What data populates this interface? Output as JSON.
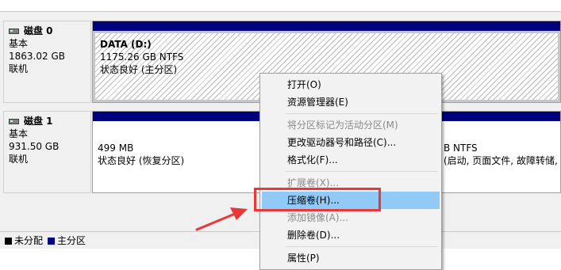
{
  "disks": [
    {
      "name": "磁盘 0",
      "type": "基本",
      "size": "1863.02 GB",
      "status": "联机",
      "volumes": [
        {
          "name": "DATA  (D:)",
          "size_fs": "1175.26 GB NTFS",
          "status": "状态良好 (主分区)"
        }
      ]
    },
    {
      "name": "磁盘 1",
      "type": "基本",
      "size": "931.50 GB",
      "status": "联机",
      "volumes": [
        {
          "size_fs": "499 MB",
          "status": "状态良好 (恢复分区)"
        },
        {
          "size_fs": "B NTFS",
          "status": "(启动, 页面文件, 故障转储, 主"
        }
      ]
    }
  ],
  "legend": [
    {
      "label": "未分配",
      "color": "#000000"
    },
    {
      "label": "主分区",
      "color": "#00007f"
    }
  ],
  "context_menu": {
    "items": [
      {
        "label": "打开(O)",
        "enabled": true
      },
      {
        "label": "资源管理器(E)",
        "enabled": true
      },
      {
        "label": "将分区标记为活动分区(M)",
        "enabled": false
      },
      {
        "label": "更改驱动器号和路径(C)...",
        "enabled": true
      },
      {
        "label": "格式化(F)...",
        "enabled": true
      },
      {
        "label": "扩展卷(X)...",
        "enabled": false
      },
      {
        "label": "压缩卷(H)...",
        "enabled": true,
        "highlighted": true
      },
      {
        "label": "添加镜像(A)...",
        "enabled": false
      },
      {
        "label": "删除卷(D)...",
        "enabled": true
      },
      {
        "label": "属性(P)",
        "enabled": true
      }
    ]
  },
  "colors": {
    "volume_header": "#00007f",
    "menu_highlight": "#91c9f7",
    "annotation_red": "#e8383a"
  }
}
